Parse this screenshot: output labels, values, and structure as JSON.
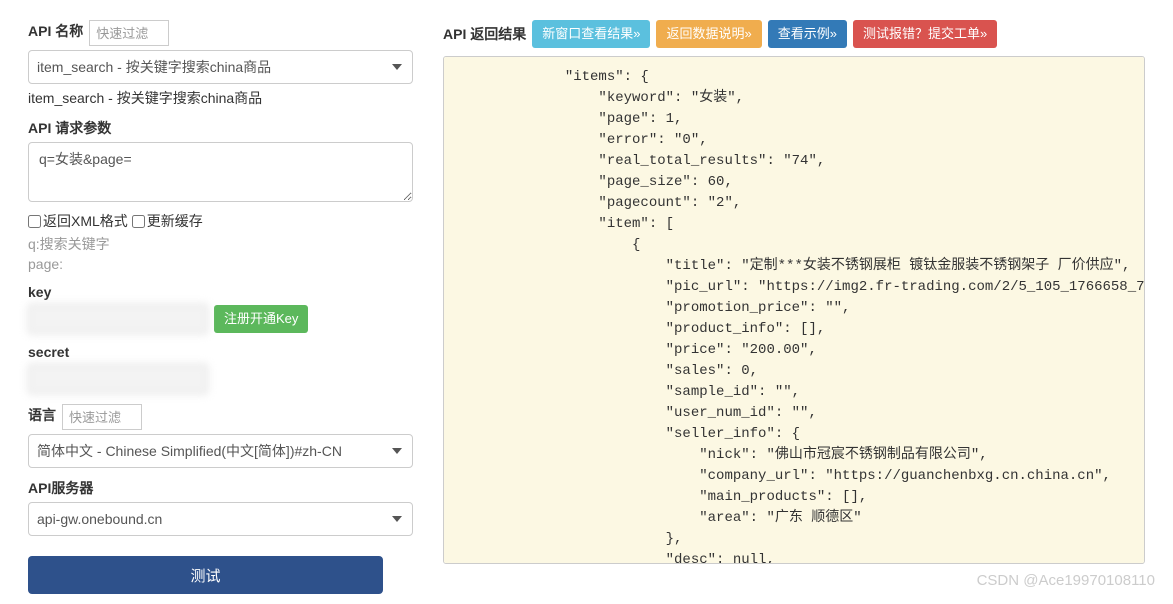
{
  "left": {
    "api_name_label": "API 名称",
    "filter_placeholder": "快速过滤",
    "api_select_value": "item_search - 按关键字搜索china商品",
    "api_helper": "item_search - 按关键字搜索china商品",
    "params_label": "API 请求参数",
    "params_value": "q=女装&page=",
    "cb_xml": "返回XML格式",
    "cb_cache": "更新缓存",
    "params_hint": "q:搜索关键字\npage:",
    "key_label": "key",
    "open_key_btn": "注册开通Key",
    "secret_label": "secret",
    "lang_label": "语言",
    "lang_filter_placeholder": "快速过滤",
    "lang_select_value": "简体中文 - Chinese Simplified(中文[简体])#zh-CN",
    "server_label": "API服务器",
    "server_value": "api-gw.onebound.cn",
    "test_btn": "测试"
  },
  "right": {
    "result_label": "API 返回结果",
    "btn_new_window": "新窗口查看结果»",
    "btn_data_desc": "返回数据说明»",
    "btn_example": "查看示例»",
    "btn_report": "测试报错？提交工单»",
    "json_text": "            \"items\": {\n                \"keyword\": \"女装\",\n                \"page\": 1,\n                \"error\": \"0\",\n                \"real_total_results\": \"74\",\n                \"page_size\": 60,\n                \"pagecount\": \"2\",\n                \"item\": [\n                    {\n                        \"title\": \"定制***女装不锈钢展柜 镀钛金服装不锈钢架子 厂价供应\",\n                        \"pic_url\": \"https://img2.fr-trading.com/2/5_105_1766658_750_750.jpg.webp\",\n                        \"promotion_price\": \"\",\n                        \"product_info\": [],\n                        \"price\": \"200.00\",\n                        \"sales\": 0,\n                        \"sample_id\": \"\",\n                        \"user_num_id\": \"\",\n                        \"seller_info\": {\n                            \"nick\": \"佛山市冠宸不锈钢制品有限公司\",\n                            \"company_url\": \"https://guanchenbxg.cn.china.cn\",\n                            \"main_products\": [],\n                            \"area\": \"广东 顺德区\"\n                        },\n                        \"desc\": null,\n                        \"detail_url\": \"https://www.china.cn/jinshujiancai/4540619366.html\""
  },
  "watermark": "CSDN @Ace19970108110"
}
